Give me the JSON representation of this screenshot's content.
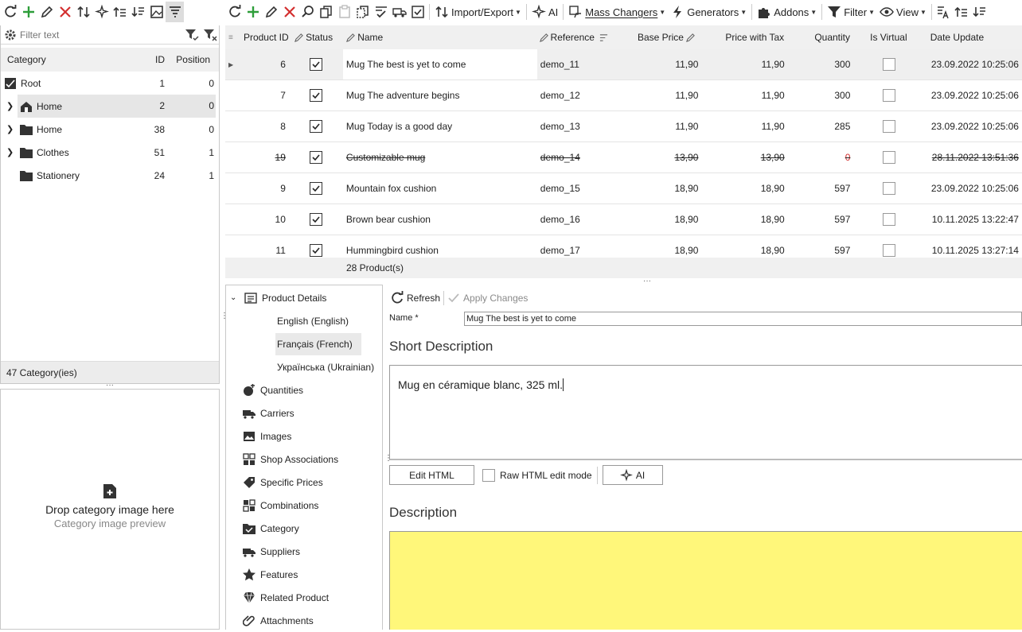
{
  "left_toolbar": {
    "icons": [
      "refresh-icon",
      "add-icon",
      "edit-icon",
      "delete-icon",
      "move-icon",
      "ai-sparkle-icon",
      "expand-up-icon",
      "sort-down-icon",
      "image-icon",
      "filter-list-icon"
    ]
  },
  "toolbar": {
    "import_export": "Import/Export",
    "ai": "AI",
    "mass_changers": "Mass Changers",
    "generators": "Generators",
    "addons": "Addons",
    "filter": "Filter",
    "view": "View"
  },
  "category_panel": {
    "filter_placeholder": "Filter text",
    "columns": {
      "category": "Category",
      "id": "ID",
      "position": "Position"
    },
    "rows": [
      {
        "name": "Root",
        "id": "1",
        "position": "0",
        "icon": "root-check-icon"
      },
      {
        "name": "Home",
        "id": "2",
        "position": "0",
        "icon": "home-icon"
      },
      {
        "name": "Home",
        "id": "38",
        "position": "0",
        "icon": "folder-icon"
      },
      {
        "name": "Clothes",
        "id": "51",
        "position": "1",
        "icon": "folder-icon"
      },
      {
        "name": "Stationery",
        "id": "24",
        "position": "1",
        "icon": "folder-icon"
      }
    ],
    "footer": "47 Category(ies)"
  },
  "image_panel": {
    "title": "Drop category image here",
    "subtitle": "Category image preview"
  },
  "grid": {
    "columns": {
      "product_id": "Product ID",
      "status": "Status",
      "name": "Name",
      "reference": "Reference",
      "base_price": "Base Price",
      "price_tax": "Price with Tax",
      "quantity": "Quantity",
      "is_virtual": "Is Virtual",
      "date_update": "Date Update"
    },
    "rows": [
      {
        "id": "6",
        "status": true,
        "name": "Mug The best is yet to come",
        "reference": "demo_11",
        "base_price": "11,90",
        "price_tax": "11,90",
        "quantity": "300",
        "is_virtual": false,
        "date_update": "23.09.2022 10:25:06"
      },
      {
        "id": "7",
        "status": true,
        "name": "Mug The adventure begins",
        "reference": "demo_12",
        "base_price": "11,90",
        "price_tax": "11,90",
        "quantity": "300",
        "is_virtual": false,
        "date_update": "23.09.2022 10:25:06"
      },
      {
        "id": "8",
        "status": true,
        "name": "Mug Today is a good day",
        "reference": "demo_13",
        "base_price": "11,90",
        "price_tax": "11,90",
        "quantity": "285",
        "is_virtual": false,
        "date_update": "23.09.2022 10:25:06"
      },
      {
        "id": "19",
        "status": true,
        "name": "Customizable mug",
        "reference": "demo_14",
        "base_price": "13,90",
        "price_tax": "13,90",
        "quantity": "0",
        "is_virtual": false,
        "date_update": "28.11.2022 13:51:36"
      },
      {
        "id": "9",
        "status": true,
        "name": "Mountain fox cushion",
        "reference": "demo_15",
        "base_price": "18,90",
        "price_tax": "18,90",
        "quantity": "597",
        "is_virtual": false,
        "date_update": "23.09.2022 10:25:06"
      },
      {
        "id": "10",
        "status": true,
        "name": "Brown bear cushion",
        "reference": "demo_16",
        "base_price": "18,90",
        "price_tax": "18,90",
        "quantity": "597",
        "is_virtual": false,
        "date_update": "10.11.2025 13:22:47"
      },
      {
        "id": "11",
        "status": true,
        "name": "Hummingbird cushion",
        "reference": "demo_17",
        "base_price": "18,90",
        "price_tax": "18,90",
        "quantity": "597",
        "is_virtual": false,
        "date_update": "10.11.2025 13:27:14"
      }
    ],
    "footer": "28 Product(s)"
  },
  "nav": {
    "product_details": "Product Details",
    "languages": [
      "English (English)",
      "Français (French)",
      "Українська (Ukrainian)"
    ],
    "items": [
      {
        "label": "Quantities",
        "icon": "quantities-icon"
      },
      {
        "label": "Carriers",
        "icon": "truck-icon"
      },
      {
        "label": "Images",
        "icon": "image-icon"
      },
      {
        "label": "Shop Associations",
        "icon": "shop-icon"
      },
      {
        "label": "Specific Prices",
        "icon": "tag-icon"
      },
      {
        "label": "Combinations",
        "icon": "grid-icon"
      },
      {
        "label": "Category",
        "icon": "folder-check-icon"
      },
      {
        "label": "Suppliers",
        "icon": "truck-supplier-icon"
      },
      {
        "label": "Features",
        "icon": "star-icon"
      },
      {
        "label": "Related Product",
        "icon": "diamond-icon"
      },
      {
        "label": "Attachments",
        "icon": "paperclip-icon"
      }
    ]
  },
  "editor": {
    "refresh": "Refresh",
    "apply_changes": "Apply Changes",
    "name_label": "Name *",
    "name_value": "Mug The best is yet to come",
    "short_description_title": "Short Description",
    "short_description_text": "Mug en céramique blanc, 325 ml.",
    "edit_html": "Edit HTML",
    "raw_html_mode": "Raw HTML edit mode",
    "ai": "AI",
    "description_title": "Description",
    "description_bg": "#fff77a"
  },
  "colors": {
    "green": "#2e9e3a",
    "red": "#d32f2f",
    "selection": "#e6e6e6",
    "header_bg": "#f0f0f0"
  }
}
